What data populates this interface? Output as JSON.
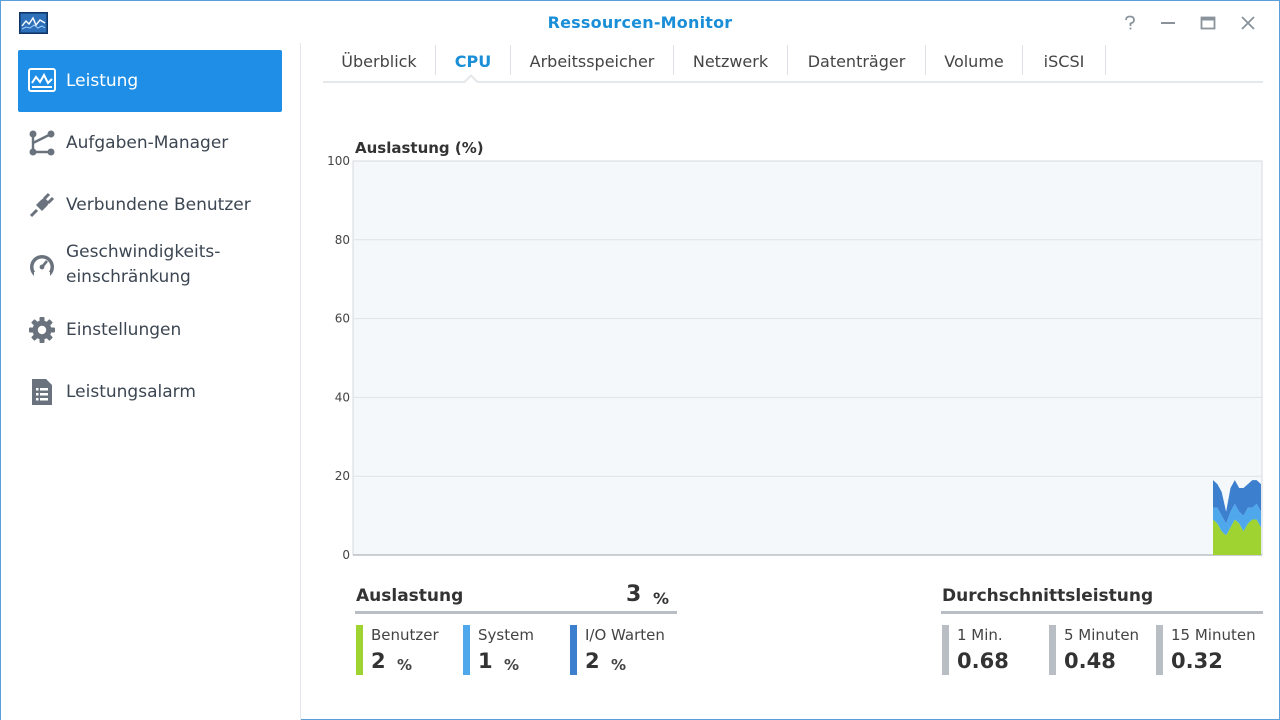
{
  "window": {
    "title": "Ressourcen-Monitor",
    "accent_color": "#1a8fd8",
    "controls": [
      "help-icon",
      "minimize-icon",
      "maximize-icon",
      "close-icon"
    ]
  },
  "sidebar": {
    "items": [
      {
        "label": "Leistung",
        "icon": "performance-chart-icon",
        "active": true
      },
      {
        "label": "Aufgaben-Manager",
        "icon": "task-manager-icon",
        "active": false
      },
      {
        "label": "Verbundene Benutzer",
        "icon": "plug-icon",
        "active": false
      },
      {
        "label": "Geschwindigkeits-",
        "label2": "einschränkung",
        "icon": "speedometer-icon",
        "active": false
      },
      {
        "label": "Einstellungen",
        "icon": "gear-icon",
        "active": false
      },
      {
        "label": "Leistungsalarm",
        "icon": "document-list-icon",
        "active": false
      }
    ]
  },
  "tabs": [
    {
      "label": "Überblick",
      "active": false
    },
    {
      "label": "CPU",
      "active": true
    },
    {
      "label": "Arbeitsspeicher",
      "active": false
    },
    {
      "label": "Netzwerk",
      "active": false
    },
    {
      "label": "Datenträger",
      "active": false
    },
    {
      "label": "Volume",
      "active": false
    },
    {
      "label": "iSCSI",
      "active": false
    }
  ],
  "chart_data": {
    "type": "area",
    "title": "Auslastung (%)",
    "xlabel": "",
    "ylabel": "",
    "ylim": [
      0,
      100
    ],
    "yticks": [
      0,
      20,
      40,
      60,
      80,
      100
    ],
    "grid": true,
    "stacked": true,
    "series": [
      {
        "name": "Benutzer",
        "color": "#9ed331",
        "values": [
          9,
          8,
          6,
          5,
          7,
          9,
          8,
          6,
          8,
          9,
          9,
          7
        ]
      },
      {
        "name": "System",
        "color": "#4fa8ec",
        "values": [
          3,
          4,
          4,
          3,
          4,
          4,
          3,
          4,
          4,
          3,
          4,
          4
        ]
      },
      {
        "name": "I/O Warten",
        "color": "#3d7fcf",
        "values": [
          7,
          6,
          6,
          3,
          6,
          6,
          6,
          7,
          6,
          7,
          6,
          7
        ]
      }
    ]
  },
  "usage": {
    "heading": "Auslastung",
    "value": "3",
    "unit": "%",
    "metrics": [
      {
        "label": "Benutzer",
        "value": "2",
        "unit": "%",
        "color": "#9ed331"
      },
      {
        "label": "System",
        "value": "1",
        "unit": "%",
        "color": "#4fa8ec"
      },
      {
        "label": "I/O Warten",
        "value": "2",
        "unit": "%",
        "color": "#3d7fcf"
      }
    ]
  },
  "load_average": {
    "heading": "Durchschnittsleistung",
    "metrics": [
      {
        "label": "1 Min.",
        "value": "0.68",
        "color": "#b9bec4"
      },
      {
        "label": "5 Minuten",
        "value": "0.48",
        "color": "#b9bec4"
      },
      {
        "label": "15 Minuten",
        "value": "0.32",
        "color": "#b9bec4"
      }
    ]
  }
}
